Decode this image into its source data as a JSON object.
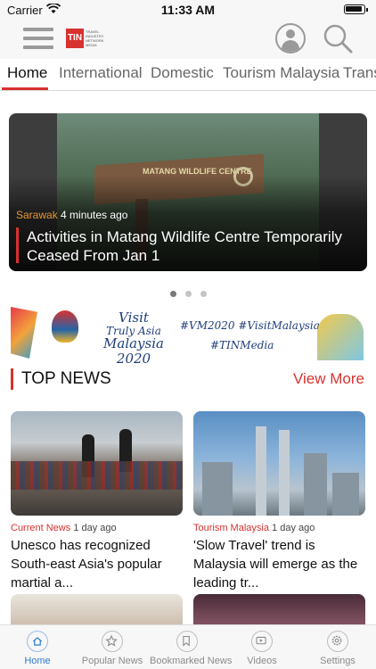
{
  "status_bar": {
    "carrier": "Carrier",
    "time": "11:33 AM"
  },
  "app_bar": {
    "logo_mark": "TIN",
    "logo_text": "TRAVEL INDUSTRY NETWORK MEDIA"
  },
  "tabs": [
    "Home",
    "International",
    "Domestic",
    "Tourism Malaysia",
    "Trans"
  ],
  "hero": {
    "category": "Sarawak",
    "time": "4 minutes ago",
    "title": "Activities in Matang Wildlife Centre Temporarily Ceased  From Jan 1",
    "sign_text": "MATANG WILDLIFE CENTRE",
    "carousel_index": 1,
    "carousel_count": 3
  },
  "banner": {
    "visit_line1": "Visit",
    "visit_line2": "Truly Asia",
    "visit_line3": "Malaysia",
    "visit_line4": "2020",
    "hashtags_line1": "#VM2020  #VisitMalaysia2020",
    "hashtags_line2": "#TINMedia"
  },
  "top_news": {
    "heading": "TOP NEWS",
    "view_more": "View More",
    "cards": [
      {
        "category": "Current News",
        "time": "1 day ago",
        "title": "Unesco has recognized South-east Asia's popular martial a..."
      },
      {
        "category": "Tourism Malaysia",
        "time": "1 day ago",
        "title": "'Slow Travel' trend is Malaysia will emerge as the leading tr..."
      }
    ]
  },
  "bottom_tabs": [
    {
      "label": "Home",
      "icon": "home-icon",
      "active": true
    },
    {
      "label": "Popular News",
      "icon": "star-icon",
      "active": false
    },
    {
      "label": "Bookmarked News",
      "icon": "bookmark-icon",
      "active": false
    },
    {
      "label": "Videos",
      "icon": "play-icon",
      "active": false
    },
    {
      "label": "Settings",
      "icon": "gear-icon",
      "active": false
    }
  ],
  "colors": {
    "accent": "#d8322f",
    "active_tab": "#2f7bd1",
    "hero_category": "#e69a36"
  }
}
